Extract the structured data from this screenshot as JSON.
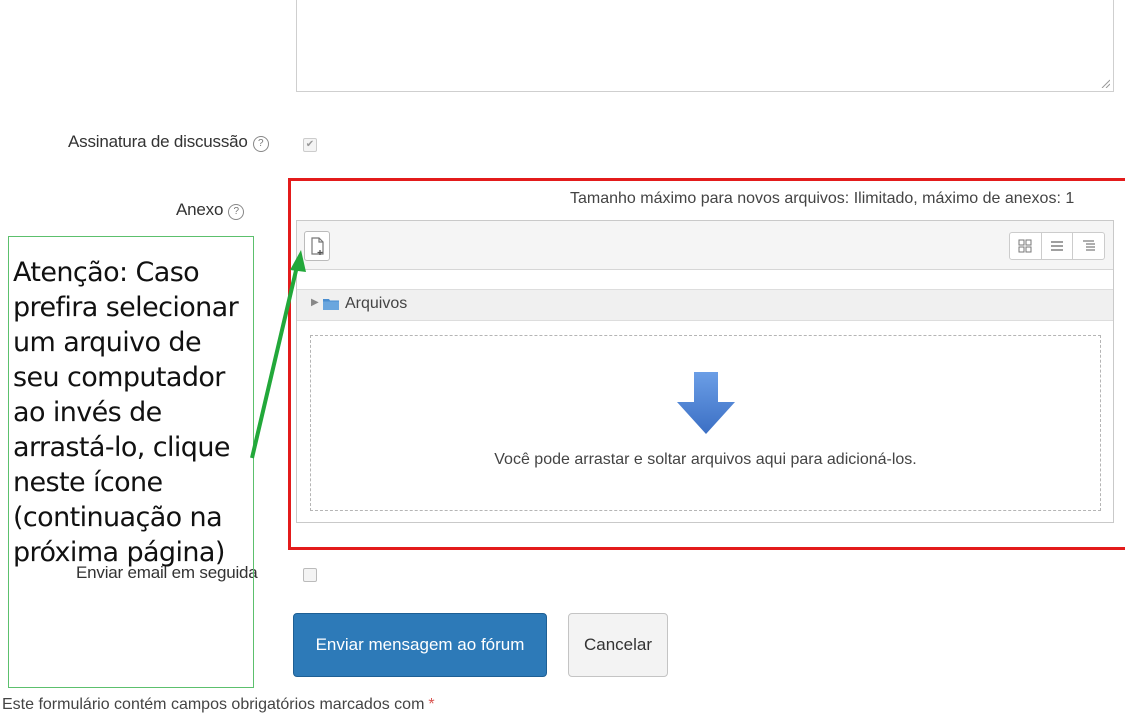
{
  "form": {
    "signature_label": "Assinatura de discussão",
    "attachment_label": "Anexo",
    "email_label": "Enviar email em seguida",
    "help_icon": "?",
    "signature_checked": true,
    "email_checked": false
  },
  "filepicker": {
    "max_size_text": "Tamanho máximo para novos arquivos: Ilimitado, máximo de anexos: 1",
    "folder_label": "Arquivos",
    "drop_text": "Você pode arrastar e soltar arquivos aqui para adicioná-los.",
    "icons": [
      "add-file-icon",
      "grid-view-icon",
      "list-view-icon",
      "tree-view-icon",
      "folder-icon",
      "down-arrow-icon"
    ]
  },
  "buttons": {
    "submit": "Enviar mensagem ao fórum",
    "cancel": "Cancelar"
  },
  "footer": {
    "required_note": "Este formulário contém campos obrigatórios marcados com",
    "required_marker": "*"
  },
  "annotation": {
    "text": "Atenção: Caso prefira selecionar um arquivo de seu computador ao invés de arrastá-lo, clique neste ícone (continuação na próxima página)"
  },
  "colors": {
    "primary_button": "#2d7ab8",
    "highlight_box": "#e31b1b",
    "annotation_border": "#5cc06d",
    "annotation_arrow": "#22a83a",
    "drop_arrow": "#4a7fd0"
  }
}
